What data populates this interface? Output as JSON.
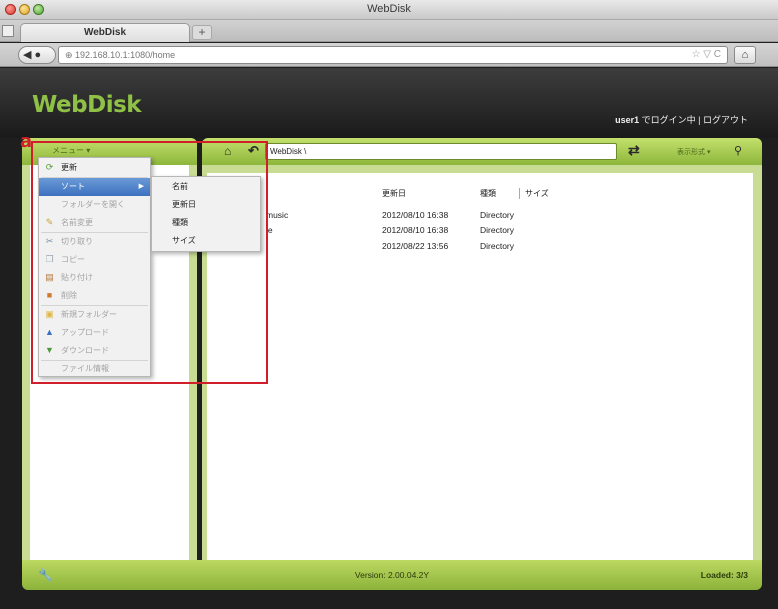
{
  "window": {
    "title": "WebDisk"
  },
  "browser": {
    "tab_label": "WebDisk",
    "new_tab": "+",
    "url": "⊕ 192.168.10.1:1080/home",
    "url_actions": "☆ ▽ C",
    "home": "⌂"
  },
  "app": {
    "logo": "WebDisk",
    "user": "user1",
    "login_status": " でログイン中 | ログアウト"
  },
  "toolbar": {
    "menu_label": "メニュー ▾",
    "path": "WebDisk \\",
    "view_format": "表示形式 ▾"
  },
  "grid": {
    "headers": {
      "modified": "更新日",
      "type": "種類",
      "size": "サイズ"
    },
    "rows": [
      {
        "name": "music",
        "modified": "2012/08/10 16:38",
        "type": "Directory"
      },
      {
        "name": "ie",
        "modified": "2012/08/10 16:38",
        "type": "Directory"
      },
      {
        "name": "",
        "modified": "2012/08/22 13:56",
        "type": "Directory"
      }
    ]
  },
  "context_menu": {
    "items": [
      {
        "label": "更新"
      },
      {
        "label": "ソート"
      },
      {
        "label": "フォルダーを開く"
      },
      {
        "label": "名前変更"
      },
      {
        "label": "切り取り"
      },
      {
        "label": "コピー"
      },
      {
        "label": "貼り付け"
      },
      {
        "label": "削除"
      },
      {
        "label": "新規フォルダー"
      },
      {
        "label": "アップロード"
      },
      {
        "label": "ダウンロード"
      },
      {
        "label": "ファイル情報"
      }
    ]
  },
  "sort_submenu": {
    "items": [
      {
        "label": "名前"
      },
      {
        "label": "更新日"
      },
      {
        "label": "種類"
      },
      {
        "label": "サイズ"
      }
    ]
  },
  "footer": {
    "version": "Version: 2.00.04.2Y",
    "loaded": "Loaded: 3/3"
  },
  "annotation": {
    "label": "a"
  },
  "colors": {
    "brand_green": "#8fc146",
    "toolbar_green": "#a5cb4f",
    "annotation_red": "#d01f2a",
    "menu_highlight": "#4a7cc8"
  }
}
